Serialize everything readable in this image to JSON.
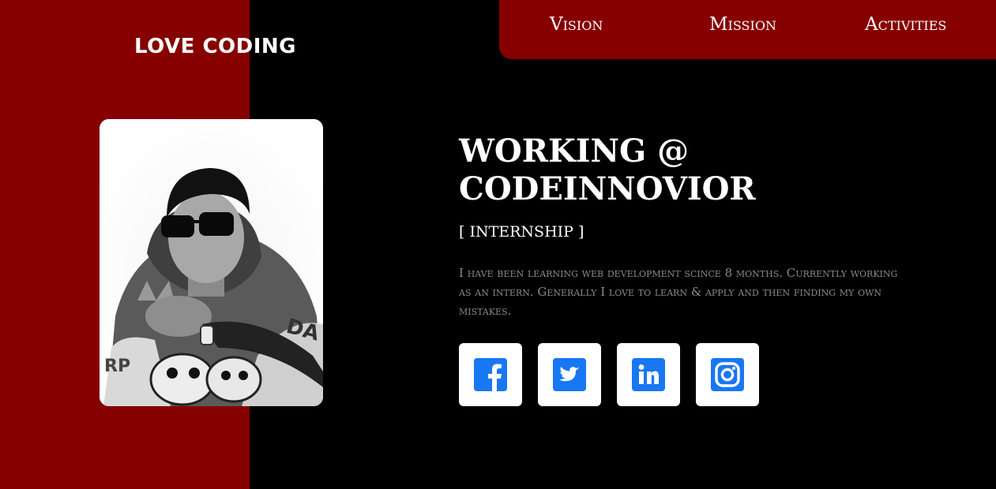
{
  "brand": {
    "logo_text": "LOVE CODING"
  },
  "nav": {
    "items": [
      {
        "label": "Vision"
      },
      {
        "label": "Mission"
      },
      {
        "label": "Activities"
      }
    ]
  },
  "profile": {
    "headline_line1": "WORKING @",
    "headline_line2": "CODEINNOVIOR",
    "subtitle": "[ INTERNSHIP ]",
    "bio": "I have been learning web development scince 8 months. Currently working as an intern. Generally I love to learn & apply and then finding my own mistakes."
  },
  "social": {
    "icons": [
      "facebook-icon",
      "twitter-icon",
      "linkedin-icon",
      "instagram-icon"
    ]
  },
  "colors": {
    "brand_red": "#860000",
    "background": "#000000",
    "social_blue": "#1877f2",
    "bio_gray": "#8a8a8a"
  }
}
